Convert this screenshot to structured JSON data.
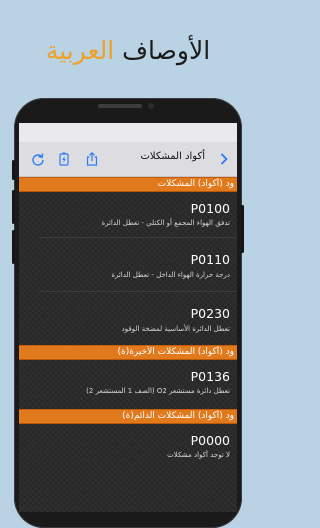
{
  "banner": {
    "word_orange": "العربية",
    "word_dark": "الأوصاف"
  },
  "toolbar": {
    "title": "أكواد المشكلات",
    "icons": [
      "refresh-icon",
      "battery-charging-icon",
      "share-icon",
      "back-chevron-icon"
    ]
  },
  "sections": [
    {
      "title": "ود (أكواد) المشكلات",
      "items": [
        {
          "code": "P0100",
          "desc": "تدفق الهواء المجمع أو الكتلي - تعطل الدائرة"
        },
        {
          "code": "P0110",
          "desc": "درجة حرارة الهواء الداخل - تعطل الدائرة"
        },
        {
          "code": "P0230",
          "desc": "تعطل الدائرة الأساسية لمضخة الوقود"
        }
      ]
    },
    {
      "title": "ود (أكواد) المشكلات الأخيرة(ة)",
      "items": [
        {
          "code": "P0136",
          "desc": "تعطل دائرة مستشعر O2 (الصف 1 المستشعر 2)"
        }
      ]
    },
    {
      "title": "ود (أكواد) المشكلات الدائم(ة)",
      "items": [
        {
          "code": "P0000",
          "desc": "لا توجد أكواد مشكلات"
        }
      ]
    }
  ],
  "colors": {
    "background": "#b9d3e4",
    "accent_orange": "#f0a026",
    "section_header": "#e07a1d",
    "ios_blue": "#2e7cf6"
  }
}
